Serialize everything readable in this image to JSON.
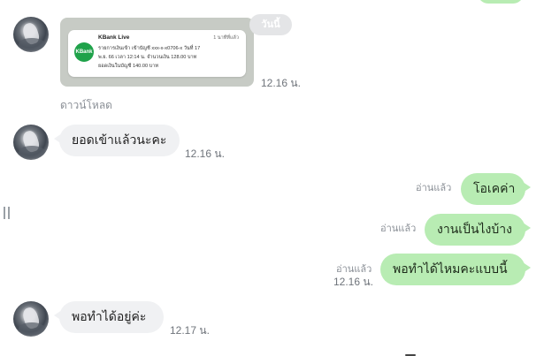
{
  "chat": {
    "date_chip": "วันนี้",
    "download_label": "ดาวน์โหลด",
    "notification_card": {
      "app_name": "KBank Live",
      "logo_text": "KBank Live",
      "ago": "1 นาทีที่แล้ว",
      "line1": "รายการเงินเข้า เข้าบัญชี xxx-x-x0706-x วันที่ 17",
      "line2": "พ.ย. 66 เวลา 12:14 น. จำนวนเงิน 128.00 บาท",
      "line3": "ยอดเงินในบัญชี 140.00 บาท"
    },
    "messages": [
      {
        "side": "left",
        "type": "image",
        "time": "12.16 น."
      },
      {
        "side": "left",
        "type": "text",
        "text": "ยอดเข้าแล้วนะคะ",
        "time": "12.16 น."
      },
      {
        "side": "right",
        "type": "text",
        "text": "โอเคค่า",
        "read": "อ่านแล้ว"
      },
      {
        "side": "right",
        "type": "text",
        "text": "งานเป็นไงบ้าง",
        "read": "อ่านแล้ว"
      },
      {
        "side": "right",
        "type": "text",
        "text": "พอทำได้ไหมคะแบบนี้",
        "read": "อ่านแล้ว",
        "time": "12.16 น."
      },
      {
        "side": "left",
        "type": "text",
        "text": "พอทำได้อยู่ค่ะ",
        "time": "12.17 น."
      }
    ]
  },
  "colors": {
    "incoming_bubble": "#f0f1f3",
    "outgoing_bubble": "#b8ecb3",
    "meta_text": "#8a8f96"
  }
}
